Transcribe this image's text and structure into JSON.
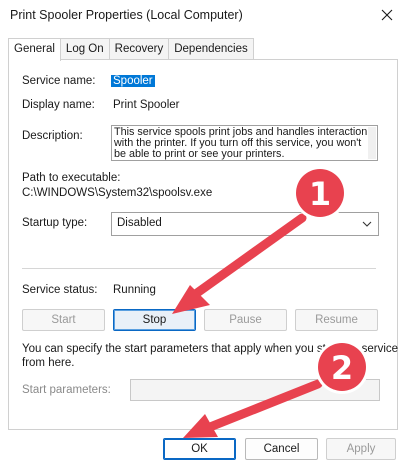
{
  "window": {
    "title": "Print Spooler Properties (Local Computer)"
  },
  "tabs": [
    {
      "label": "General",
      "active": true
    },
    {
      "label": "Log On",
      "active": false
    },
    {
      "label": "Recovery",
      "active": false
    },
    {
      "label": "Dependencies",
      "active": false
    }
  ],
  "general": {
    "service_name_label": "Service name:",
    "service_name_value": "Spooler",
    "display_name_label": "Display name:",
    "display_name_value": "Print Spooler",
    "description_label": "Description:",
    "description_value": "This service spools print jobs and handles interaction\nwith the printer.  If you turn off this service, you won't\nbe able to print or see your printers.",
    "path_label": "Path to executable:",
    "path_value": "C:\\WINDOWS\\System32\\spoolsv.exe",
    "startup_type_label": "Startup type:",
    "startup_type_value": "Disabled",
    "service_status_label": "Service status:",
    "service_status_value": "Running",
    "start_label": "Start",
    "stop_label": "Stop",
    "pause_label": "Pause",
    "resume_label": "Resume",
    "hint_line1": "You can specify the start parameters that apply when you start the service",
    "hint_line2": "from here.",
    "start_params_label": "Start parameters:",
    "start_params_value": ""
  },
  "footer": {
    "ok_label": "OK",
    "cancel_label": "Cancel",
    "apply_label": "Apply"
  },
  "annotations": {
    "marker1": "1",
    "marker2": "2",
    "marker_color": "#e8424f"
  },
  "colors": {
    "accent": "#0a68c4",
    "selection": "#0078d7"
  },
  "icons": {
    "close": "close-icon",
    "dropdown": "chevron-down-icon"
  }
}
